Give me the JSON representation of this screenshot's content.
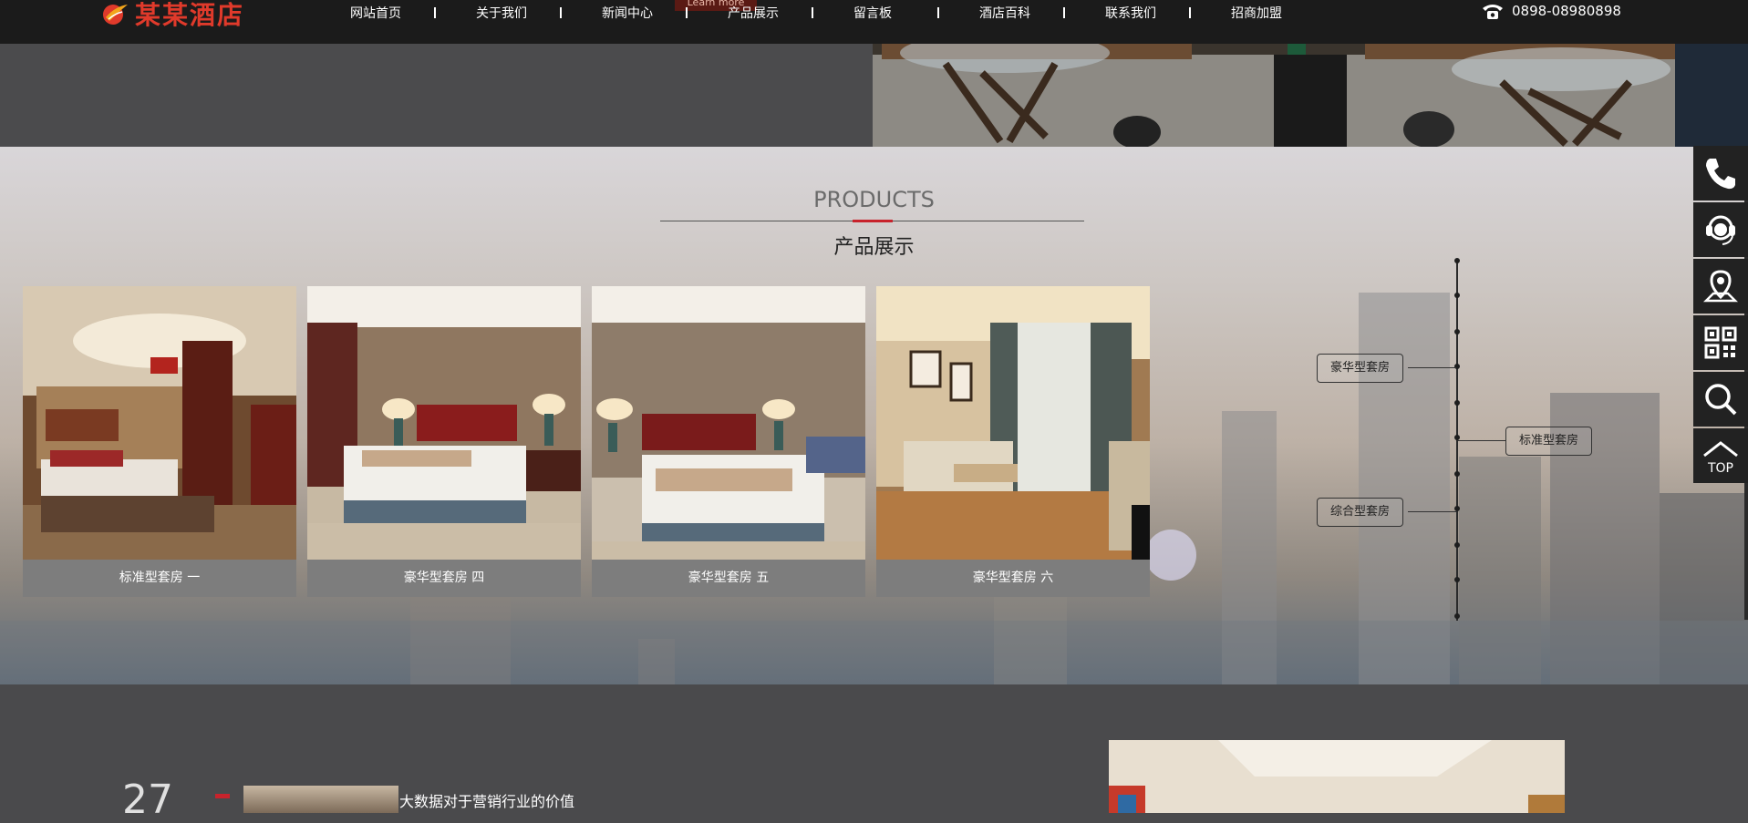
{
  "header": {
    "logo_text": "某某酒店",
    "nav": [
      "网站首页",
      "关于我们",
      "新闻中心",
      "产品展示",
      "留言板",
      "酒店百科",
      "联系我们",
      "招商加盟"
    ],
    "learn_more": "Learn more",
    "phone": "0898-08980898"
  },
  "products": {
    "title_en": "PRODUCTS",
    "title_cn": "产品展示",
    "items": [
      {
        "label": "标准型套房 一"
      },
      {
        "label": "豪华型套房 四"
      },
      {
        "label": "豪华型套房 五"
      },
      {
        "label": "豪华型套房 六"
      }
    ],
    "categories": [
      "豪华型套房",
      "标准型套房",
      "综合型套房"
    ]
  },
  "side_tools": [
    "phone-icon",
    "customer-service-icon",
    "location-icon",
    "qrcode-icon",
    "search-icon",
    "top-icon"
  ],
  "side_tools_top_label": "TOP",
  "news": {
    "day": "27",
    "title": "大数据对于营销行业的价值"
  },
  "colors": {
    "accent": "#c8232c",
    "topbar": "#1b1b1b",
    "logo": "#e03a2b"
  }
}
